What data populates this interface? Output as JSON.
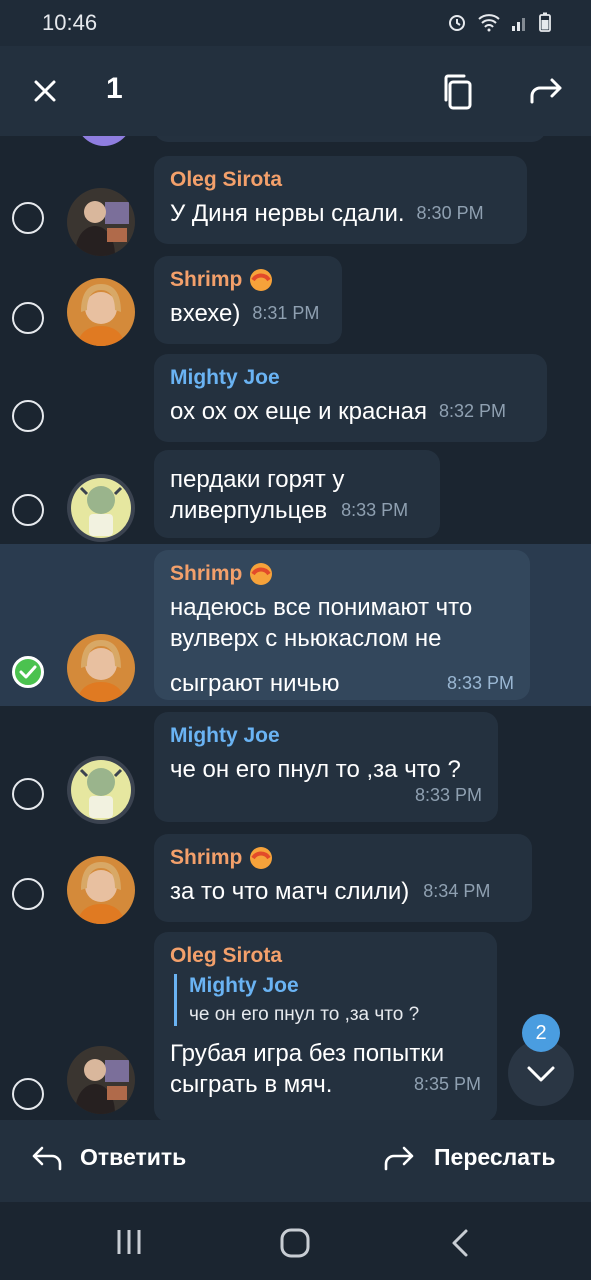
{
  "status": {
    "time": "10:46"
  },
  "topbar": {
    "count": "1"
  },
  "messages": [
    {
      "sender": "Oleg Sirota",
      "text": "У Диня нервы сдали.",
      "time": "8:30 PM"
    },
    {
      "sender": "Shrimp",
      "text": "вхехе)",
      "time": "8:31 PM"
    },
    {
      "sender": "Mighty Joe",
      "text": "ох ох ох еще и красная",
      "time": "8:32 PM"
    },
    {
      "text_line1": "пердаки горят у",
      "text_line2": "ливерпульцев",
      "time": "8:33 PM"
    },
    {
      "sender": "Shrimp",
      "text_line1": "надеюсь все понимают что",
      "text_line2": "вулверх с ньюкаслом не",
      "text_line3": "сыграют ничью",
      "time": "8:33 PM"
    },
    {
      "sender": "Mighty Joe",
      "text": "че он его пнул то ,за что ?",
      "time": "8:33 PM"
    },
    {
      "sender": "Shrimp",
      "text": "за то что матч слили)",
      "time": "8:34 PM"
    },
    {
      "sender": "Oleg Sirota",
      "reply_name": "Mighty Joe",
      "reply_text": "че он его пнул то ,за что ?",
      "text_line1": "Грубая игра без попытки",
      "text_line2": "сыграть в мяч.",
      "time": "8:35 PM"
    }
  ],
  "fab": {
    "badge": "2"
  },
  "bottombar": {
    "reply_label": "Ответить",
    "forward_label": "Переслать"
  },
  "colors": {
    "orange_name": "#f3a06b",
    "blue_name": "#6ab3f3",
    "check": "#4bc24f"
  }
}
